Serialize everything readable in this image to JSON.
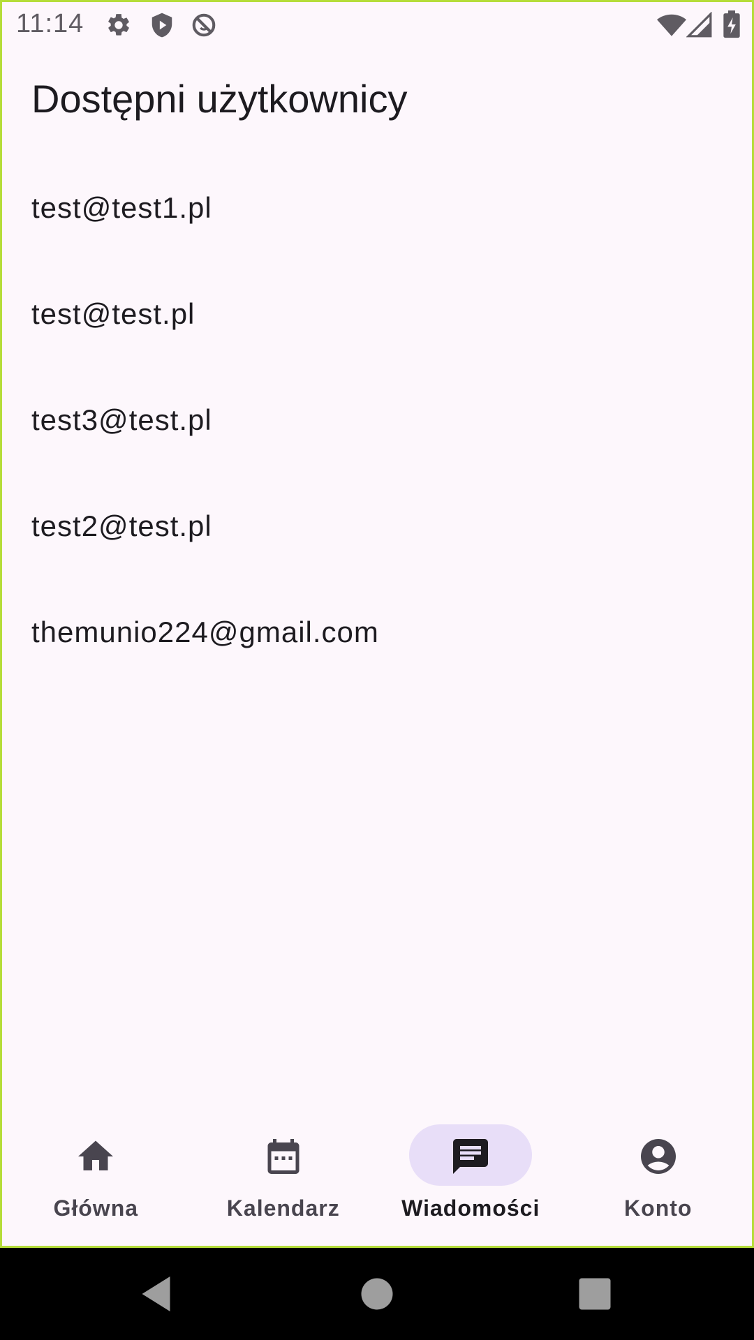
{
  "status_bar": {
    "time": "11:14",
    "left_icons": [
      "settings-icon",
      "shield-play-icon",
      "do-not-disturb-icon"
    ],
    "right_icons": [
      "wifi-icon",
      "signal-icon",
      "battery-charging-icon"
    ]
  },
  "page": {
    "title": "Dostępni użytkownicy"
  },
  "users": [
    "test@test1.pl",
    "test@test.pl",
    "test3@test.pl",
    "test2@test.pl",
    "themunio224@gmail.com"
  ],
  "bottom_nav": {
    "items": [
      {
        "label": "Główna",
        "icon": "home-icon",
        "active": false
      },
      {
        "label": "Kalendarz",
        "icon": "calendar-icon",
        "active": false
      },
      {
        "label": "Wiadomości",
        "icon": "chat-icon",
        "active": true
      },
      {
        "label": "Konto",
        "icon": "account-icon",
        "active": false
      }
    ]
  },
  "colors": {
    "background": "#fdf7fc",
    "text_primary": "#1d1b20",
    "text_secondary": "#49454f",
    "active_pill": "#e8def8",
    "frame_border": "#b5dd3a"
  }
}
